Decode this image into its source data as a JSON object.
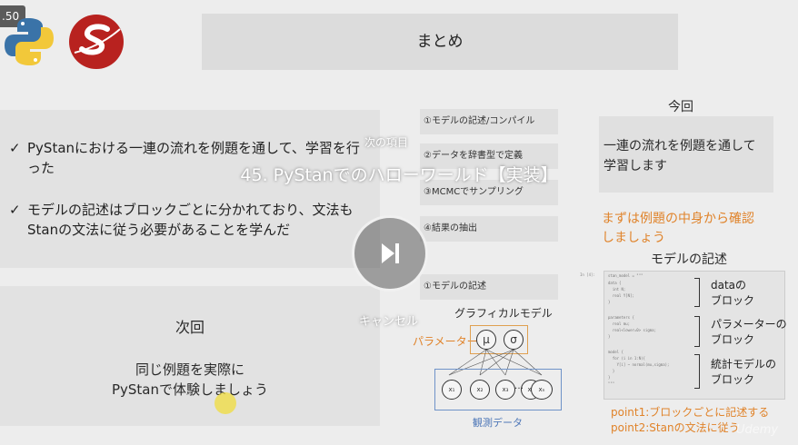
{
  "player": {
    "speed": ".50",
    "overlay_title": "45. PyStanでのハローワールド【実装】",
    "next_label": "次の項目",
    "cancel_label": "キャンセル",
    "watermark": "Udemy"
  },
  "slide": {
    "title": "まとめ",
    "summary": {
      "items": [
        "PyStanにおける一連の流れを例題を通して、学習を行った",
        "モデルの記述はブロックごとに分かれており、文法もStanの文法に従う必要があることを学んだ"
      ],
      "check": "✓"
    },
    "next_time": {
      "heading": "次回",
      "line1": "同じ例題を実際に",
      "line2": "PyStanで体験しましょう"
    },
    "steps": [
      "①モデルの記述/コンパイル",
      "②データを辞書型で定義",
      "③MCMCでサンプリング",
      "④結果の抽出",
      "①モデルの記述"
    ],
    "graphical_model": {
      "title": "グラフィカルモデル",
      "param_label": "パラメーター",
      "mu": "μ",
      "sigma": "σ",
      "obs_nodes": [
        "x₁",
        "x₂",
        "x₃",
        "x₄",
        "…",
        "xₙ"
      ],
      "obs_label": "観測データ"
    },
    "this_time": {
      "heading": "今回",
      "line1": "一連の流れを例題を通して",
      "line2": "学習します"
    },
    "orange_note": {
      "line1": "まずは例題の中身から確認",
      "line2": "しましょう"
    },
    "model_desc": {
      "heading": "モデルの記述",
      "prompt": "In [4]:",
      "code": [
        "stan_model = \"\"\"",
        "data {",
        "  int N;",
        "  real Y[N];",
        "}",
        "",
        "parameters {",
        "  real mu;",
        "  real<lower=0> sigma;",
        "}",
        "",
        "model {",
        "  for (i in 1:N){",
        "    Y[i] ~ normal(mu,sigma);",
        "  }",
        "}",
        "\"\"\""
      ],
      "block_labels": [
        {
          "line1": "dataの",
          "line2": "ブロック"
        },
        {
          "line1": "パラメーターの",
          "line2": "ブロック"
        },
        {
          "line1": "統計モデルの",
          "line2": "ブロック"
        }
      ],
      "point1": "point1:ブロックごとに記述する",
      "point2": "point2:Stanの文法に従う"
    }
  }
}
